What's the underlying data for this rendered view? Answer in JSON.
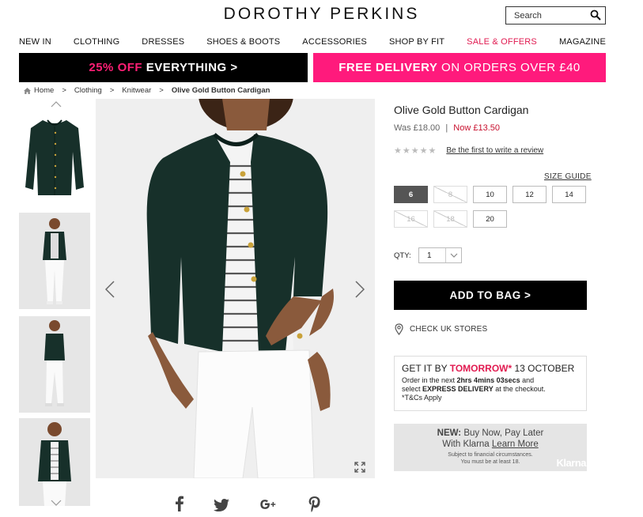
{
  "header": {
    "logo": "DOROTHY PERKINS",
    "search_placeholder": "Search"
  },
  "nav": [
    "NEW IN",
    "CLOTHING",
    "DRESSES",
    "SHOES & BOOTS",
    "ACCESSORIES",
    "SHOP BY FIT",
    "SALE & OFFERS",
    "MAGAZINE"
  ],
  "promo": {
    "left_pink": "25% OFF",
    "left_rest": " EVERYTHING >",
    "right_bold": "FREE DELIVERY",
    "right_rest": " ON ORDERS OVER £40"
  },
  "breadcrumb": [
    "Home",
    ">",
    "Clothing",
    ">",
    "Knitwear",
    ">",
    "Olive Gold Button Cardigan"
  ],
  "product": {
    "title": "Olive Gold Button Cardigan",
    "was": "Was £18.00",
    "sep": "|",
    "now": "Now £13.50",
    "stars": "★★★★★",
    "review_link": "Be the first to write a review",
    "size_guide": "SIZE GUIDE",
    "sizes": [
      "6",
      "8",
      "10",
      "12",
      "14",
      "16",
      "18",
      "20"
    ],
    "qty_label": "QTY:",
    "qty_value": "1",
    "add_to_bag": "ADD TO BAG >",
    "check_stores": "CHECK UK STORES"
  },
  "delivery": {
    "get_it": "GET IT BY ",
    "tomorrow": "TOMORROW*",
    "date": " 13 OCTOBER",
    "line1_a": "Order in the next ",
    "line1_b": "2hrs 4mins 03secs",
    "line1_c": " and",
    "line2_a": "select ",
    "line2_b": "EXPRESS DELIVERY",
    "line2_c": " at the checkout.",
    "tcs": "*T&Cs Apply"
  },
  "klarna": {
    "new": "NEW:",
    "line1": " Buy Now, Pay Later",
    "line2": "With Klarna ",
    "learn": "Learn More",
    "small1": "Subject to financial circumstances.",
    "small2": "You must be at least 18.",
    "brand": "Klarna"
  },
  "colors": {
    "accent_pink": "#ff1a7c",
    "sale_red": "#e11a50",
    "garment": "#17302a"
  }
}
